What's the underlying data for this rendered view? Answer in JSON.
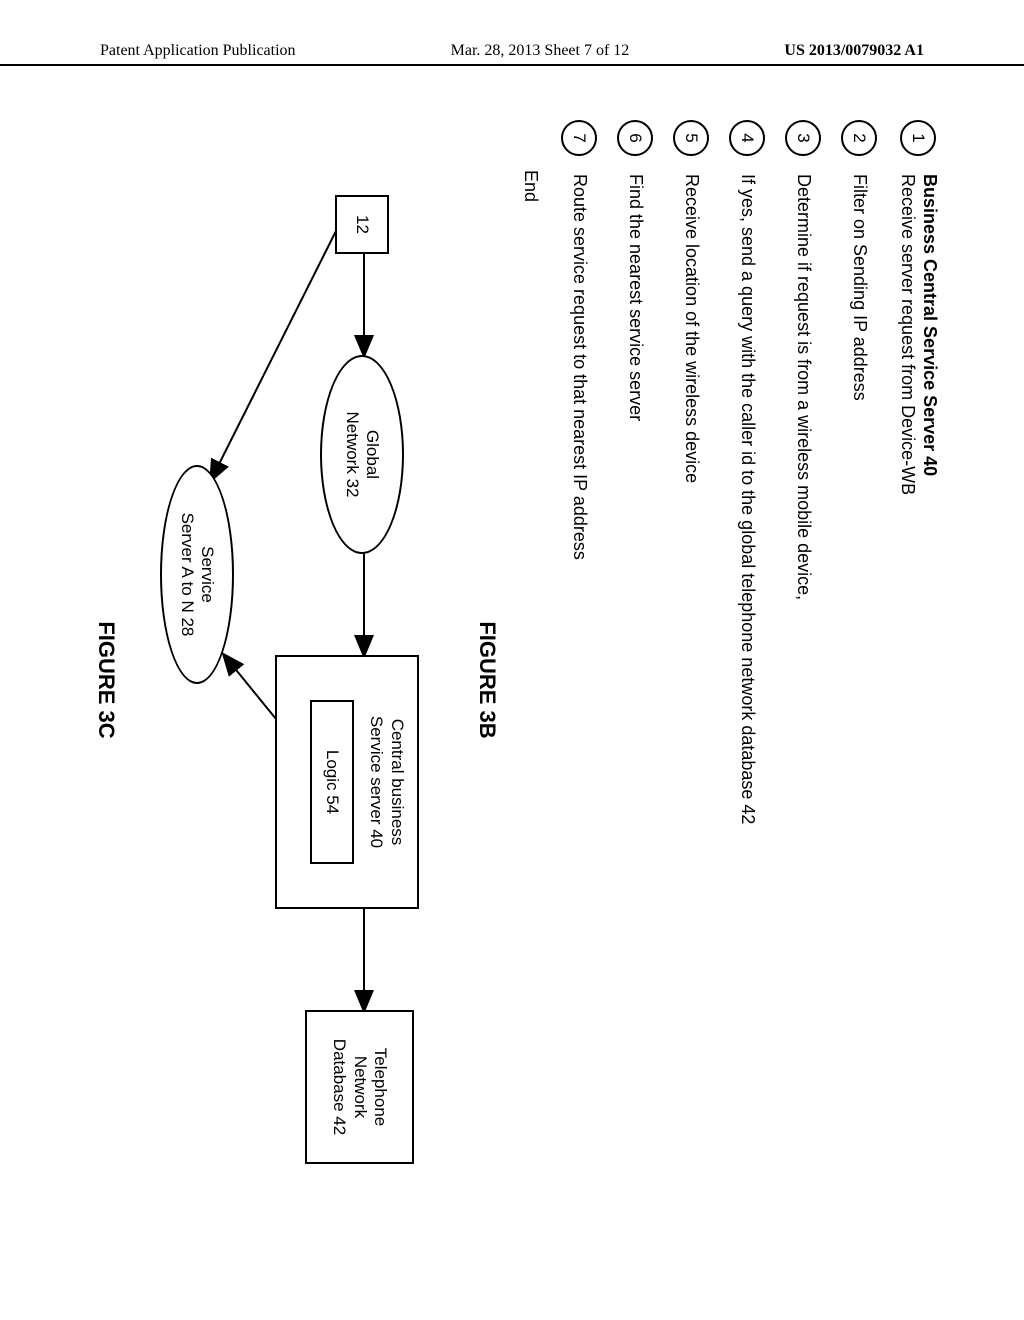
{
  "header": {
    "left": "Patent Application Publication",
    "center": "Mar. 28, 2013  Sheet 7 of 12",
    "right": "US 2013/0079032 A1"
  },
  "figure3b": {
    "title": "Business Central Service Server 40",
    "steps": [
      "Receive server request from Device-WB",
      "Filter on Sending IP address",
      "Determine if request is from a wireless mobile device,",
      "If yes, send a query with the caller id to the global telephone network database 42",
      "Receive location of the wireless device",
      "Find the nearest service server",
      "Route service request to that nearest IP address"
    ],
    "end": "End",
    "label": "FIGURE 3B"
  },
  "figure3c": {
    "nodes": {
      "device": "12",
      "global_network": "Global\nNetwork 32",
      "central_server": "Central business\nService server 40",
      "logic": "Logic 54",
      "telephone_db": "Telephone\nNetwork\nDatabase 42",
      "service_server": "Service\nServer A to N 28"
    },
    "label": "FIGURE 3C"
  }
}
